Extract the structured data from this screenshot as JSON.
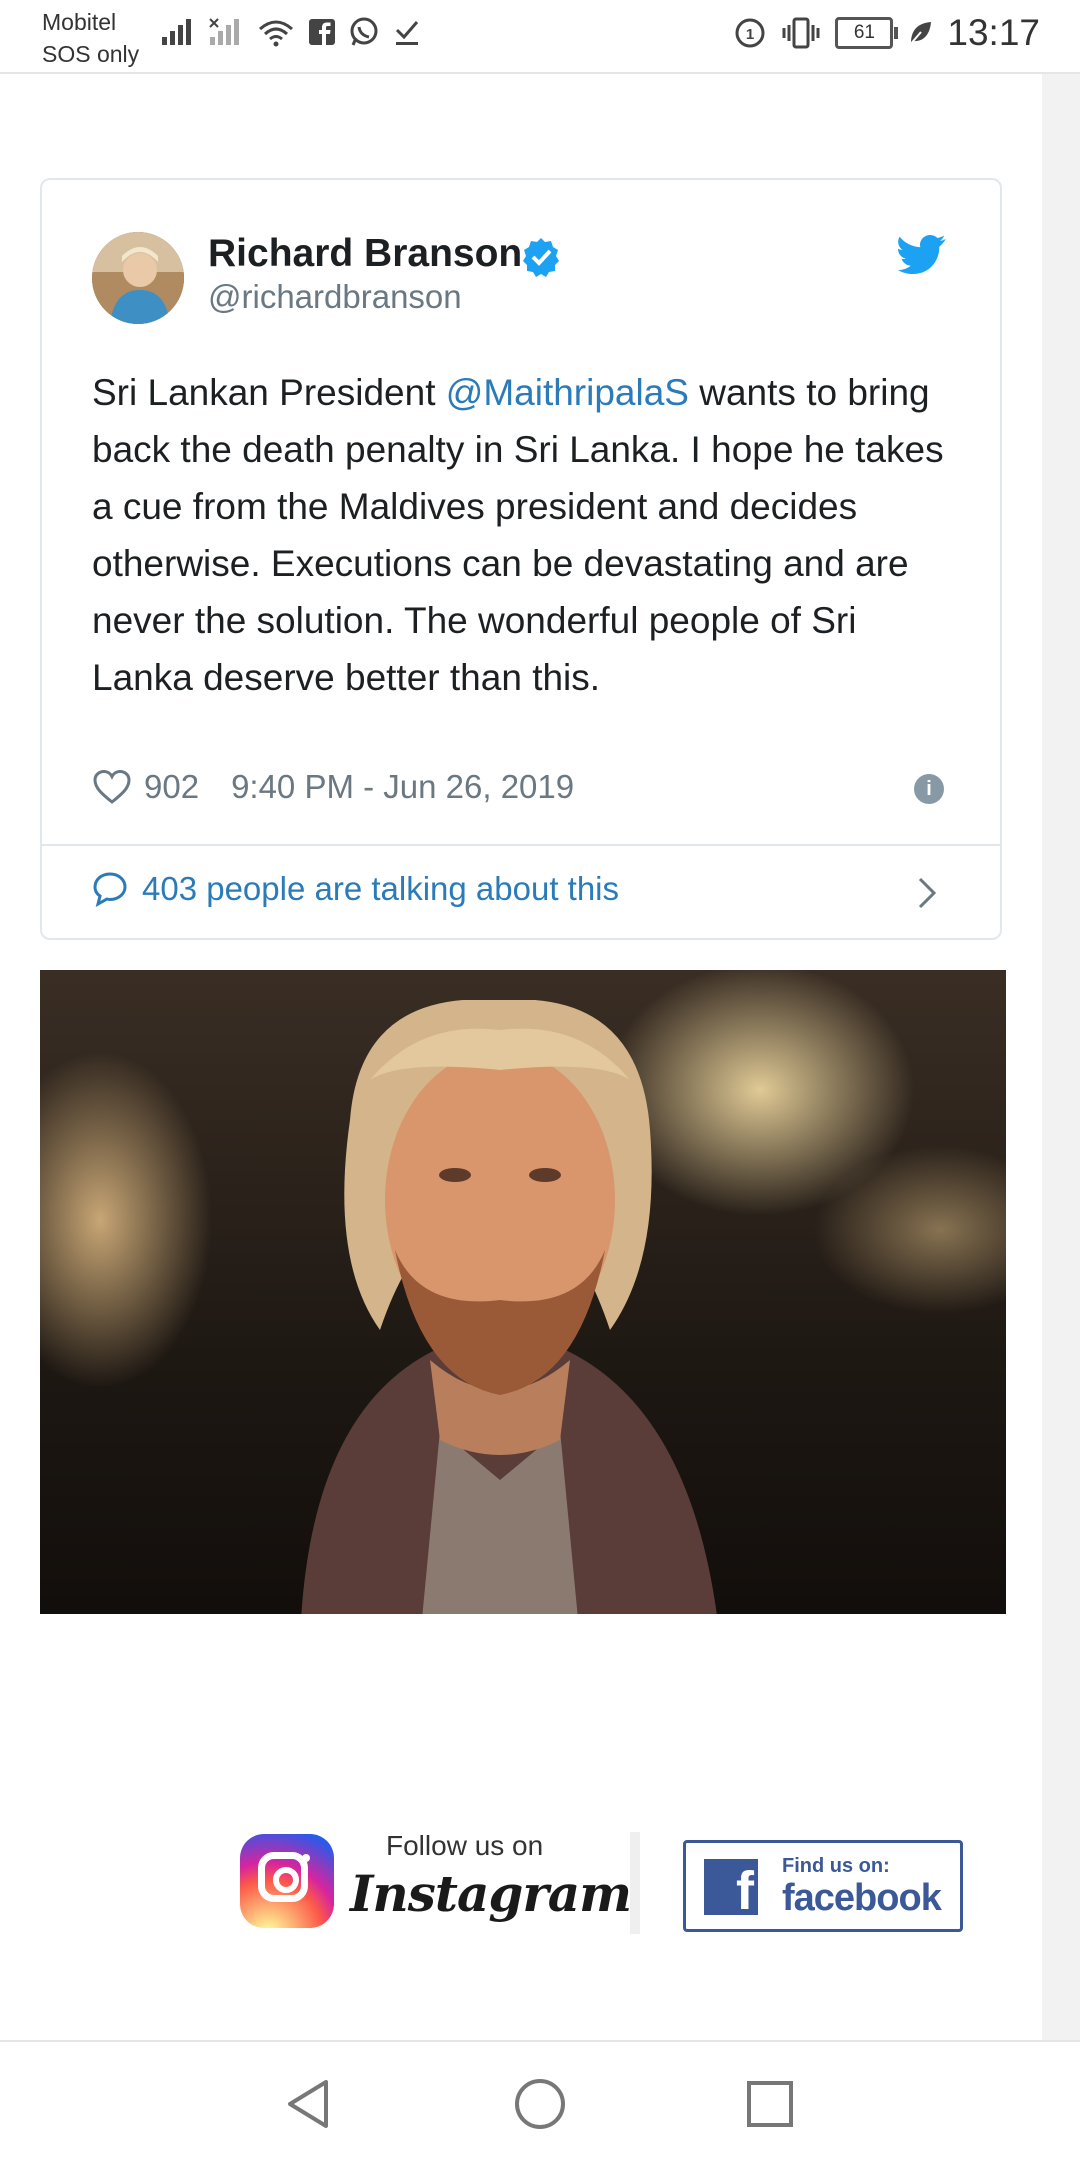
{
  "status_bar": {
    "carrier_line1": "Mobitel",
    "carrier_line2": "SOS only",
    "battery": "61",
    "time": "13:17",
    "icons": [
      "signal-icon",
      "no-signal-icon",
      "wifi-icon",
      "facebook-icon",
      "whatsapp-icon",
      "download-done-icon",
      "data-saver-icon",
      "vibrate-icon",
      "battery-icon",
      "leaf-icon"
    ]
  },
  "tweet": {
    "author_name": "Richard Branson",
    "author_handle": "@richardbranson",
    "text_before_mention": "Sri Lankan President ",
    "mention": "@MaithripalaS",
    "text_after_mention": " wants to bring back the death penalty in Sri Lanka. I hope he takes a cue from the Maldives president and decides otherwise. Executions can be devastating and are never the solution. The wonderful people of Sri Lanka deserve better than this.",
    "likes": "902",
    "timestamp": "9:40 PM - Jun 26, 2019",
    "talking": "403 people are talking about this",
    "colors": {
      "link": "#2b7bb9",
      "verified": "#1da1f2",
      "bird": "#1da1f2",
      "muted": "#697882"
    }
  },
  "photo": {
    "subject": "portrait-photo"
  },
  "social": {
    "ig_follow": "Follow us on",
    "ig_word": "Instagram",
    "fb_find": "Find us on:",
    "fb_word": "facebook",
    "fb_letter": "f"
  },
  "nav": {
    "buttons": [
      "back-button",
      "home-button",
      "recents-button"
    ]
  }
}
